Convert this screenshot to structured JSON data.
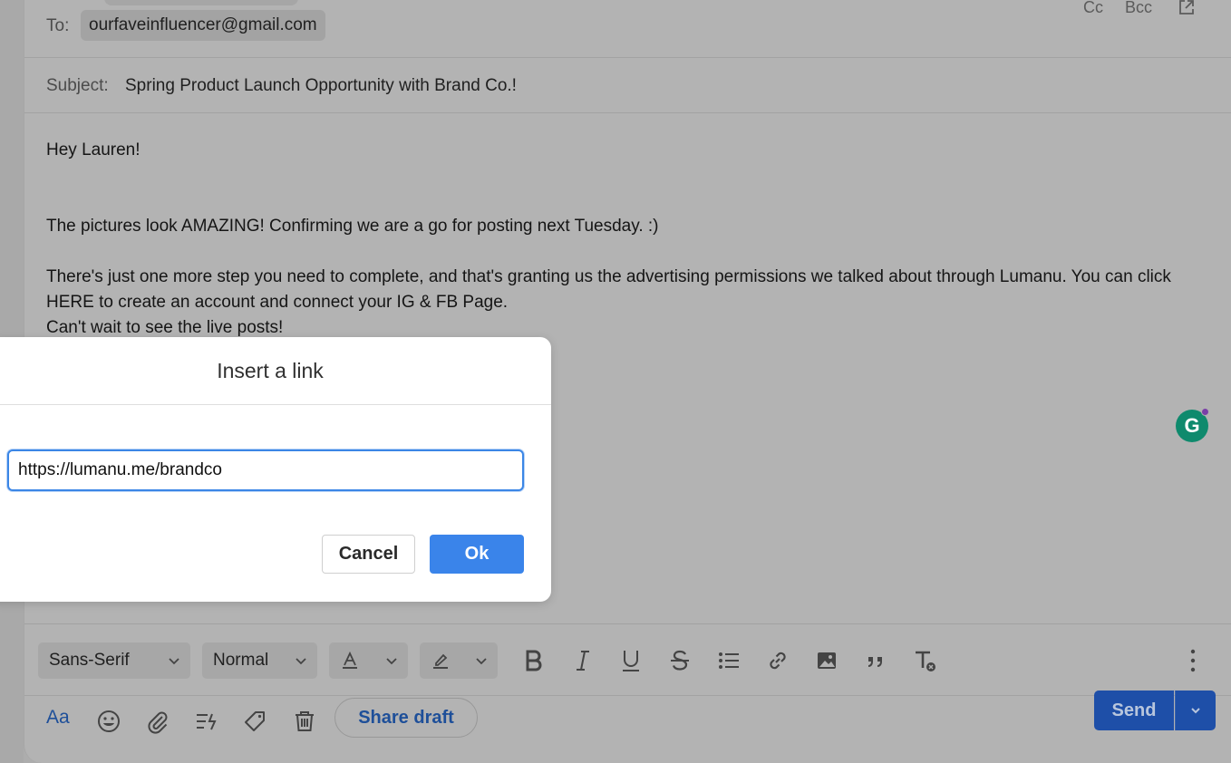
{
  "compose": {
    "to_label": "To:",
    "to_recipient": "ourfaveinfluencer@gmail.com",
    "cc_label": "Cc",
    "bcc_label": "Bcc",
    "subject_label": "Subject:",
    "subject": "Spring Product Launch Opportunity with Brand Co.!",
    "body": {
      "greeting": "Hey Lauren!",
      "line1": "The pictures look AMAZING! Confirming we are a go for posting next Tuesday. :)",
      "line2": "There's just one more step you need to complete, and that's granting us the advertising permissions we talked about through Lumanu. You can click HERE to create an account and connect your IG & FB Page.",
      "line3": "Can't wait to see the live posts!"
    }
  },
  "toolbar": {
    "font": "Sans-Serif",
    "size": "Normal",
    "icons": [
      "text-color-icon",
      "highlight-icon",
      "bold-icon",
      "italic-icon",
      "underline-icon",
      "strikethrough-icon",
      "bullet-list-icon",
      "link-icon",
      "image-icon",
      "quote-icon",
      "clear-format-icon",
      "more-options-icon"
    ]
  },
  "bottombar": {
    "aa_label": "Aa",
    "share_draft_label": "Share draft",
    "send_label": "Send"
  },
  "dialog": {
    "title": "Insert a link",
    "url_value": "https://lumanu.me/brandco",
    "cancel_label": "Cancel",
    "ok_label": "Ok"
  },
  "grammarly": {
    "letter": "G"
  },
  "colors": {
    "primary_blue": "#3a84ea",
    "send_blue": "#1e4fa8",
    "grammarly_green": "#0f8a6d"
  }
}
